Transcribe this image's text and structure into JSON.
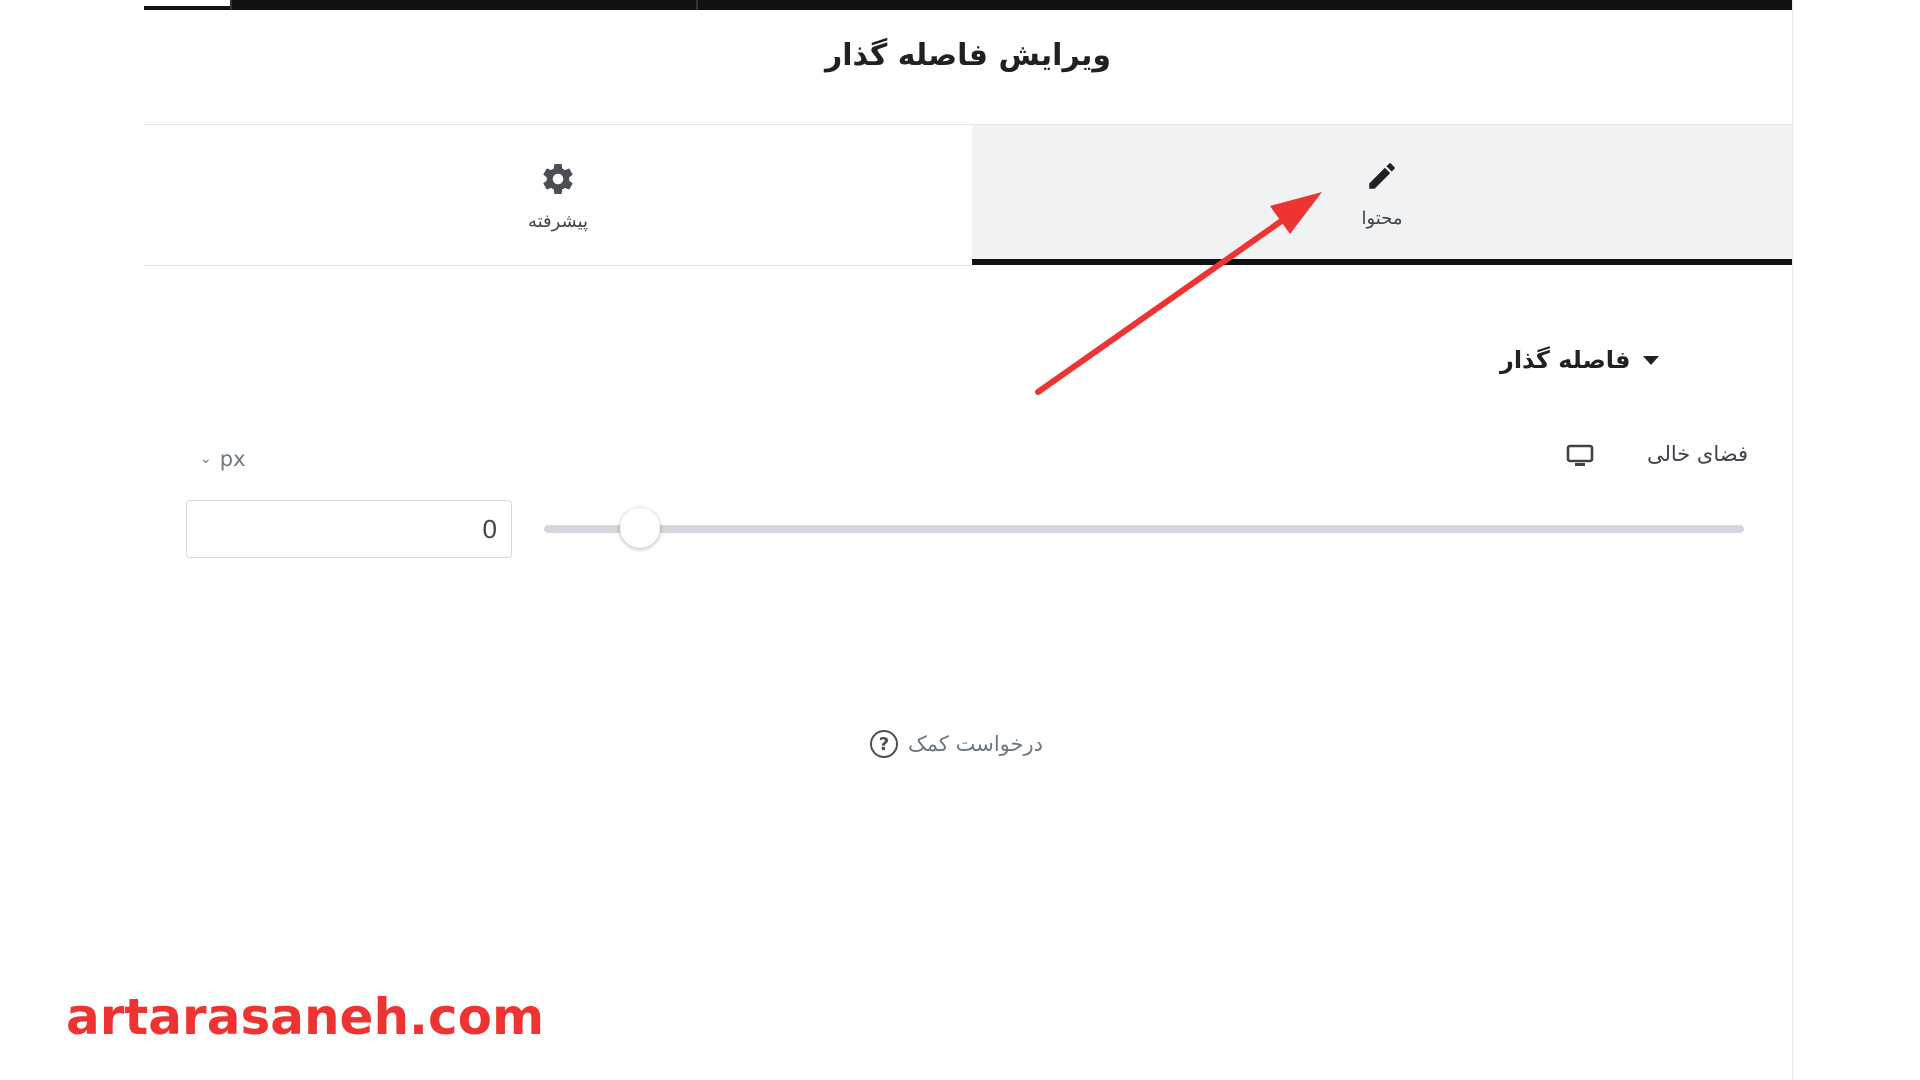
{
  "panel": {
    "title": "ویرایش فاصله گذار"
  },
  "tabs": [
    {
      "label": "پیشرفته",
      "icon": "gear-icon",
      "active": false
    },
    {
      "label": "محتوا",
      "icon": "pencil-icon",
      "active": true
    }
  ],
  "section": {
    "title": "فاصله گذار",
    "expanded": true
  },
  "control": {
    "label": "فضای خالی",
    "device_icon": "desktop-icon",
    "unit": "px",
    "value": "0",
    "slider_fraction": 0.08
  },
  "help": {
    "label": "درخواست کمک"
  },
  "watermark": {
    "text": "artarasaneh.com"
  },
  "colors": {
    "accent": "#111111",
    "annotation": "#ee3333",
    "active_tab_bg": "#f1f2f3"
  }
}
